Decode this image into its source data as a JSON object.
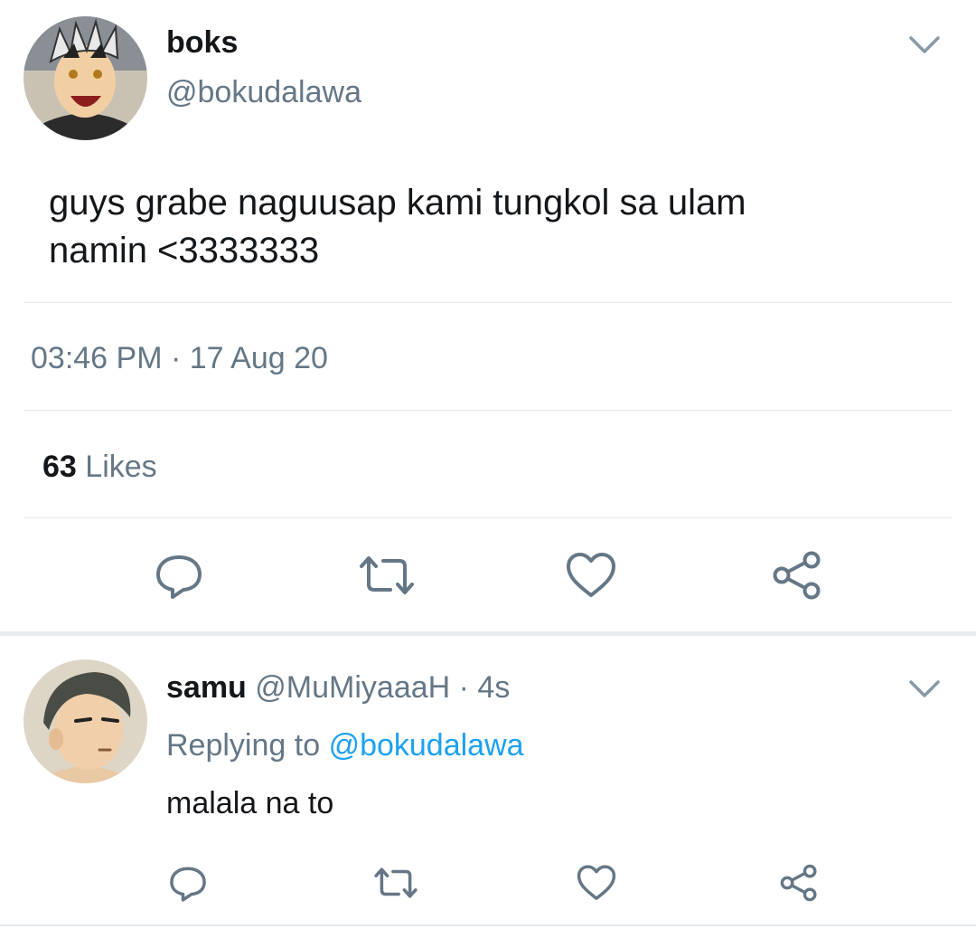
{
  "main_tweet": {
    "display_name": "boks",
    "handle": "@bokudalawa",
    "text_line1": "guys grabe naguusap kami tungkol sa ulam",
    "text_line2": "namin <3333333",
    "time": "03:46 PM",
    "separator": "·",
    "date": "17 Aug 20",
    "likes_count": "63",
    "likes_label": "Likes"
  },
  "reply": {
    "display_name": "samu",
    "handle": "@MuMiyaaaH",
    "time_sep": "·",
    "time": "4s",
    "replying_label": "Replying to",
    "replying_handle": "@bokudalawa",
    "text": "malala na to"
  },
  "colors": {
    "text": "#14171a",
    "muted": "#657786",
    "link": "#1da1f2",
    "divider": "#e1e8ed"
  },
  "icons": [
    "chevron-down-icon",
    "reply-icon",
    "retweet-icon",
    "like-icon",
    "share-icon"
  ]
}
